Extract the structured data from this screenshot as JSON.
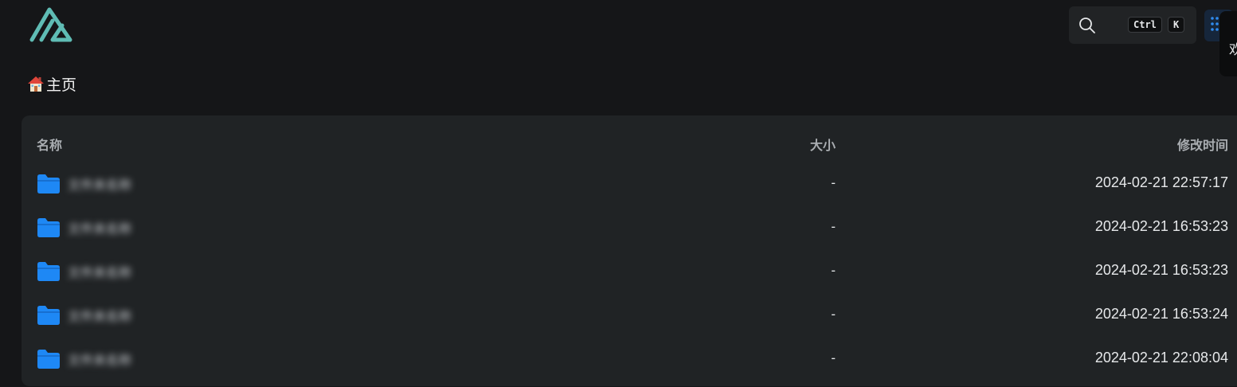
{
  "app": {
    "logo_icon": "alist-logo-icon",
    "accent_color": "#5fbcb4"
  },
  "search": {
    "icon": "search-icon",
    "shortcut_ctrl": "Ctrl",
    "shortcut_key": "K"
  },
  "side_tab": {
    "label": "欢"
  },
  "breadcrumb": {
    "icon": "house-emoji-icon",
    "label": "主页"
  },
  "table": {
    "columns": {
      "name": "名称",
      "size": "大小",
      "modified": "修改时间"
    },
    "folder_color": "#1e88f5",
    "rows": [
      {
        "name": "文件夹名称",
        "size": "-",
        "modified": "2024-02-21 22:57:17"
      },
      {
        "name": "文件夹名称",
        "size": "-",
        "modified": "2024-02-21 16:53:23"
      },
      {
        "name": "文件夹名称",
        "size": "-",
        "modified": "2024-02-21 16:53:23"
      },
      {
        "name": "文件夹名称",
        "size": "-",
        "modified": "2024-02-21 16:53:24"
      },
      {
        "name": "文件夹名称",
        "size": "-",
        "modified": "2024-02-21 22:08:04"
      }
    ]
  }
}
